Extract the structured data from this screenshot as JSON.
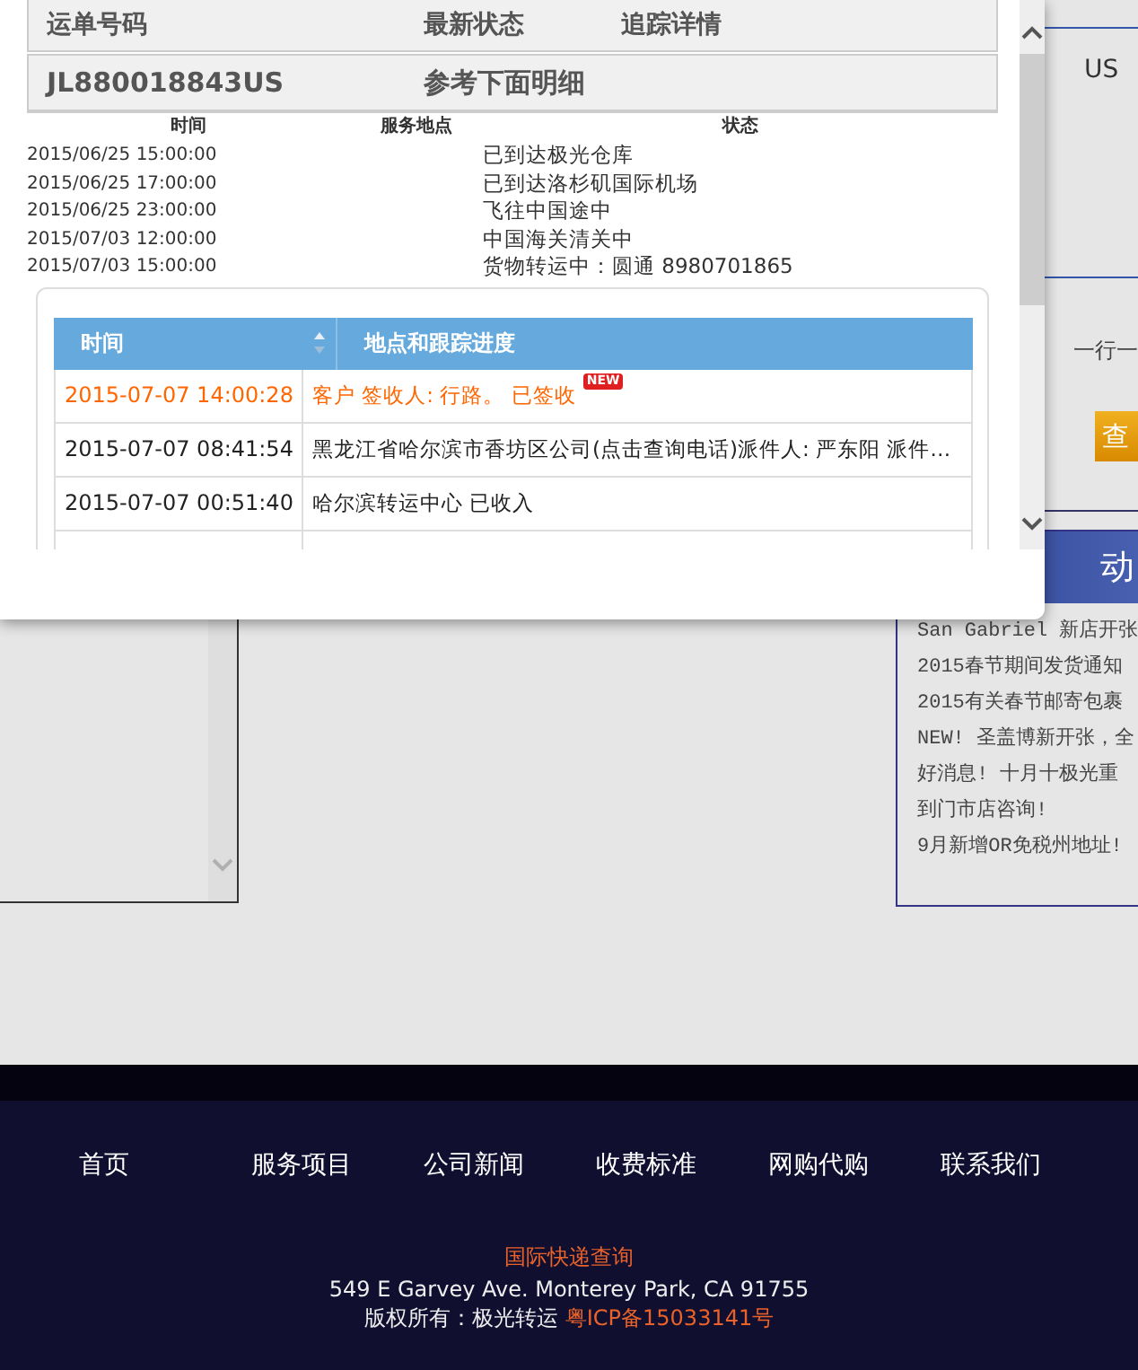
{
  "background": {
    "right_panel": {
      "fragment_text": "US",
      "line_text": "一行一",
      "query_button": "查",
      "banner": "动",
      "news": [
        "San Gabriel 新店开张",
        "2015春节期间发货通知",
        "2015有关春节邮寄包裹",
        "NEW! 圣盖博新开张，全",
        "好消息! 十月十极光重",
        "到门市店咨询!",
        "9月新增OR免税州地址!"
      ]
    }
  },
  "dialog": {
    "summary_header": [
      "运单号码",
      "最新状态",
      "追踪详情"
    ],
    "summary_row": {
      "tracking_number": "JL880018843US",
      "latest_status": "参考下面明细"
    },
    "detail_columns": [
      "时间",
      "服务地点",
      "状态"
    ],
    "detail_rows": [
      {
        "time": "2015/06/25 15:00:00",
        "status": "已到达极光仓库"
      },
      {
        "time": "2015/06/25 17:00:00",
        "status": "已到达洛杉矶国际机场"
      },
      {
        "time": "2015/06/25 23:00:00",
        "status": "飞往中国途中"
      },
      {
        "time": "2015/07/03 12:00:00",
        "status": "中国海关清关中"
      },
      {
        "time": "2015/07/03 15:00:00",
        "status": "货物转运中：圆通 8980701865"
      }
    ],
    "tracking_table": {
      "columns": [
        "时间",
        "地点和跟踪进度"
      ],
      "rows": [
        {
          "time": "2015-07-07 14:00:28",
          "progress": "客户 签收人: 行路。 已签收",
          "highlight": true,
          "badge": "NEW"
        },
        {
          "time": "2015-07-07 08:41:54",
          "progress": "黑龙江省哈尔滨市香坊区公司(点击查询电话)派件人: 严东阳 派件…",
          "highlight": false
        },
        {
          "time": "2015-07-07 00:51:40",
          "progress": "哈尔滨转运中心 已收入",
          "highlight": false
        }
      ]
    }
  },
  "footer": {
    "nav": [
      "首页",
      "服务项目",
      "公司新闻",
      "收费标准",
      "网购代购",
      "联系我们"
    ],
    "title": "国际快递查询",
    "address": "549 E Garvey Ave. Monterey Park, CA 91755",
    "copyright": "版权所有：极光转运",
    "icp": "粤ICP备15033141号"
  }
}
